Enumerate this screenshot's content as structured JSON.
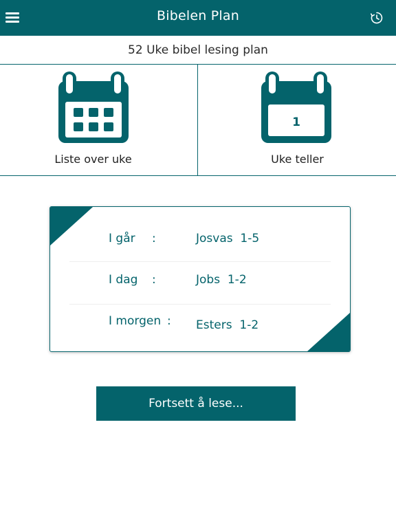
{
  "header": {
    "title": "Bibelen Plan",
    "menu_icon": "hamburger-menu-icon",
    "history_icon": "clock-history-icon"
  },
  "plan": {
    "title": "52 Uke bibel lesing plan"
  },
  "tiles": {
    "week_list": {
      "label": "Liste over uke",
      "icon": "calendar-grid-icon"
    },
    "week_counter": {
      "label": "Uke teller",
      "icon": "calendar-number-icon",
      "number": "1"
    }
  },
  "readings": [
    {
      "label": "I går",
      "separator": ":",
      "value": "Josvas  1-5"
    },
    {
      "label": "I dag",
      "separator": ":",
      "value": "Jobs  1-2"
    },
    {
      "label": "I morgen",
      "separator": ":",
      "value": "Esters  1-2"
    }
  ],
  "continue_button": {
    "label": "Fortsett å lese..."
  },
  "colors": {
    "primary": "#04636b",
    "background": "#ffffff",
    "text": "#222222"
  }
}
